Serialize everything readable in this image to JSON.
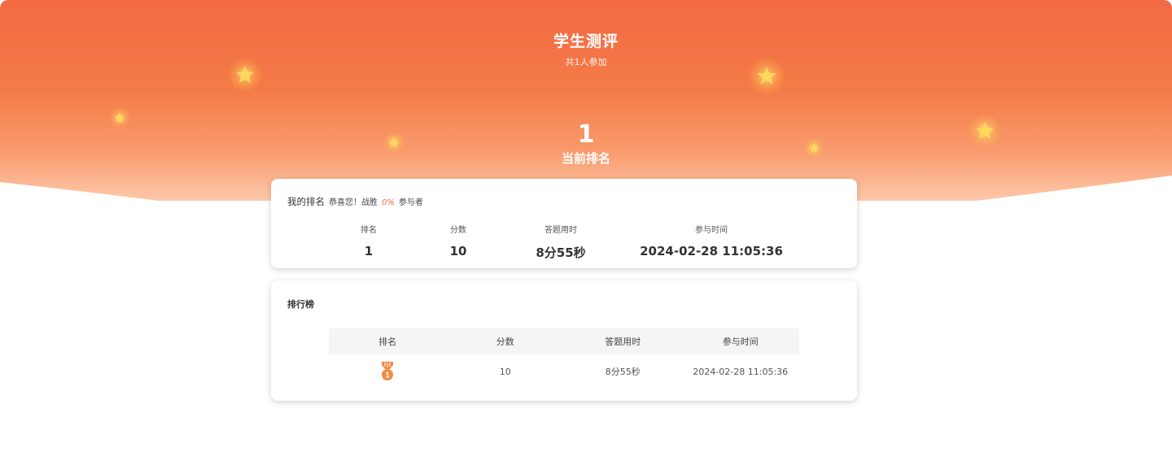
{
  "header": {
    "title": "学生测评",
    "participants": "共1人参加",
    "rank_value": "1",
    "rank_label": "当前排名"
  },
  "my_rank": {
    "label": "我的排名",
    "congrats": "恭喜您！战胜",
    "percent": "0%",
    "suffix": "参与者",
    "columns": [
      "排名",
      "分数",
      "答题用时",
      "参与时间"
    ],
    "values": [
      "1",
      "10",
      "8分55秒",
      "2024-02-28 11:05:36"
    ]
  },
  "leaderboard": {
    "title": "排行榜",
    "columns": [
      "排名",
      "分数",
      "答题用时",
      "参与时间"
    ],
    "rows": [
      {
        "rank": "1",
        "score": "10",
        "duration": "8分55秒",
        "time": "2024-02-28 11:05:36"
      }
    ]
  },
  "colors": {
    "gradient_top": "#f26a44",
    "gradient_mid": "#f58250",
    "gradient_bottom": "#fdc6a8",
    "accent": "#f26b3f",
    "star": "#ffd75a",
    "medal": "#f28a45"
  },
  "icons": {
    "star": "star-icon",
    "medal": "medal-icon"
  }
}
